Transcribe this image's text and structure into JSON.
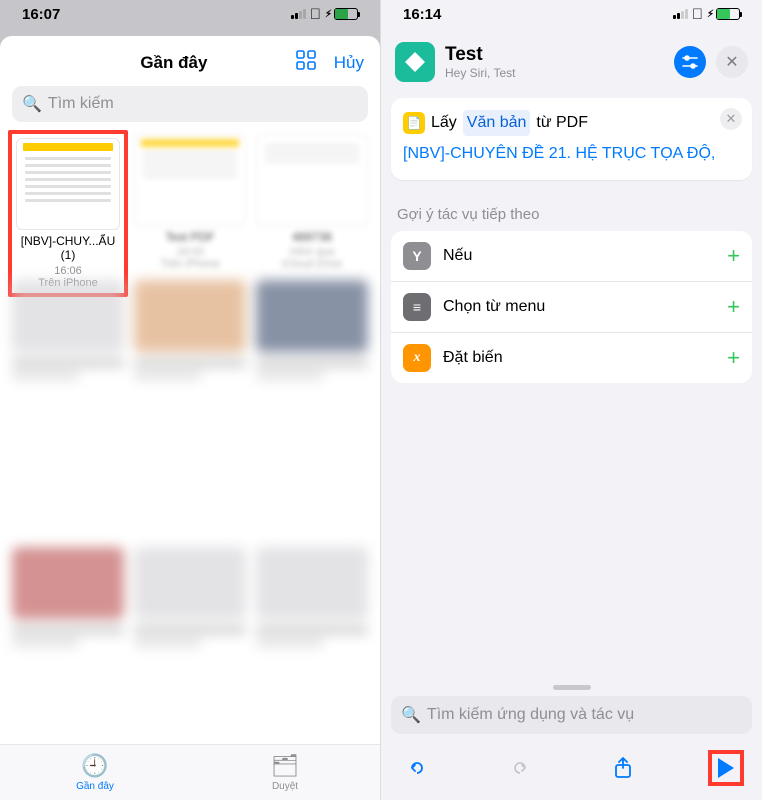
{
  "left": {
    "statusTime": "16:07",
    "sheetTitle": "Gần đây",
    "cancel": "Hủy",
    "searchPlaceholder": "Tìm kiếm",
    "files": [
      {
        "name": "[NBV]-CHUY...ẨU (1)",
        "time": "16:06",
        "loc": "Trên iPhone"
      },
      {
        "name": "Test PDF",
        "time": "16:03",
        "loc": "Trên iPhone"
      },
      {
        "name": "489736",
        "time": "Hôm qua",
        "loc": "iCloud Drive"
      }
    ],
    "tabs": {
      "recent": "Gần đây",
      "browse": "Duyệt"
    }
  },
  "right": {
    "statusTime": "16:14",
    "title": "Test",
    "subtitle": "Hey Siri, Test",
    "action": {
      "verb": "Lấy",
      "token": "Văn bản",
      "mid": "từ PDF",
      "file": "[NBV]-CHUYÊN ĐỀ 21. HỆ TRỤC TỌA ĐỘ,"
    },
    "suggestLabel": "Gợi ý tác vụ tiếp theo",
    "suggestions": [
      {
        "icon": "Y",
        "label": "Nếu"
      },
      {
        "icon": "≡",
        "label": "Chọn từ menu"
      },
      {
        "icon": "x",
        "label": "Đặt biến"
      }
    ],
    "searchPlaceholder": "Tìm kiếm ứng dụng và tác vụ"
  }
}
